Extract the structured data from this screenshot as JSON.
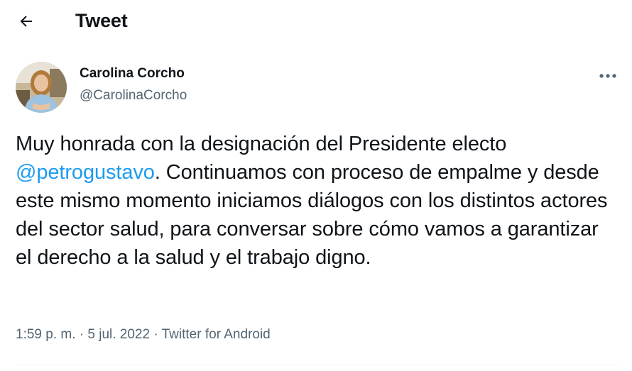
{
  "header": {
    "title": "Tweet",
    "back_icon": "arrow-left-icon"
  },
  "tweet": {
    "author": {
      "name": "Carolina Corcho",
      "handle": "@CarolinaCorcho",
      "avatar_icon": "avatar-photo"
    },
    "more_icon": "more-horizontal-icon",
    "text_before": "Muy honrada con la designación del Presidente electo ",
    "mention": "@petrogustavo",
    "text_after": ". Continuamos con proceso de empalme y desde este mismo momento iniciamos diálogos con los distintos actores del sector salud, para conversar sobre cómo vamos a garantizar el derecho a la salud y el trabajo digno.",
    "time": "1:59 p. m.",
    "separator": " · ",
    "date": "5 jul. 2022",
    "source": "Twitter for Android"
  },
  "colors": {
    "text": "#0f1419",
    "secondary": "#536471",
    "link": "#1d9bf0",
    "divider": "#eff3f4"
  }
}
